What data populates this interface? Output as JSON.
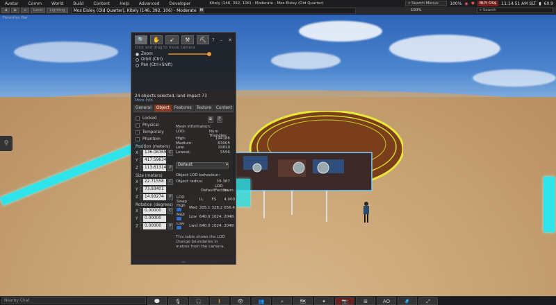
{
  "menubar": {
    "items": [
      "Avatar",
      "Comm",
      "World",
      "Build",
      "Content",
      "Help",
      "Advanced",
      "Developer"
    ],
    "status_text": "Kitely (146, 392, 106) - Moderate - Mos Eisley (Old Quarter)",
    "search_placeholder": "Search Menus",
    "volume": "100%",
    "buy_label": "BUY OS$",
    "time": "11:14:51 AM SLT",
    "fps": "60.9"
  },
  "navbar": {
    "back_label": "Land",
    "lighting_label": "Lighting",
    "location": "Mos Eisley (Old Quarter), Kitely (146, 392, 106) - Moderate",
    "maturity_badge": "M",
    "zoom": "100%",
    "search_placeholder": "Search"
  },
  "favorites_label": "Favorites Bar",
  "build": {
    "hint": "Click and drag to move camera",
    "camera_modes": [
      "Zoom",
      "Orbit (Ctrl)",
      "Pan (Ctrl+Shift)"
    ],
    "selected_mode": 0,
    "selection_info": "24 objects selected, land impact 73",
    "more_info": "More info",
    "tabs": [
      "General",
      "Object",
      "Features",
      "Texture",
      "Content"
    ],
    "active_tab": 1,
    "checkboxes": [
      "Locked",
      "Physical",
      "Temporary",
      "Phantom"
    ],
    "position_label": "Position (meters)",
    "position": [
      "136.08369",
      "417.59634",
      "113.61314"
    ],
    "size_label": "Size (meters)",
    "size": [
      "22.71558",
      "73.93401",
      "14.93274"
    ],
    "rotation_label": "Rotation (degrees)",
    "rotation": [
      "0.00000",
      "0.00000",
      "0.00000"
    ],
    "mesh_info_label": "Mesh Information:",
    "lod_label": "LOD:",
    "num_triangles_label": "Num Triangles",
    "mesh_rows": [
      {
        "k": "High:",
        "v": "194186"
      },
      {
        "k": "Medium:",
        "v": "63005"
      },
      {
        "k": "Low:",
        "v": "19810"
      },
      {
        "k": "Lowest:",
        "v": "5556"
      }
    ],
    "dropdown_value": "Default",
    "lod_behaviour_label": "Object LOD behaviour:",
    "object_radius_label": "Object radius:",
    "object_radius_value": "39.387",
    "lod_factors_label": "LOD Factors",
    "default_label": "Default",
    "yours_label": "Yours",
    "lod_swap_header": [
      "LOD Swap",
      "LL",
      "FS",
      "4.000"
    ],
    "lod_swap_rows": [
      {
        "from": "High",
        "to": "Med",
        "ll": "205.1",
        "fs": "328.2",
        "yours": "656.4"
      },
      {
        "from": "Med",
        "to": "Low",
        "ll": "640.0",
        "fs": "1024.",
        "yours": "2048."
      },
      {
        "from": "Low",
        "to": "Lwst",
        "ll": "640.0",
        "fs": "1024.",
        "yours": "2048."
      }
    ],
    "note": "This table shows the LOD change boundaries in metres from the camera."
  },
  "bottombar": {
    "chat_placeholder": "Nearby Chat",
    "ao_label": "AO"
  }
}
